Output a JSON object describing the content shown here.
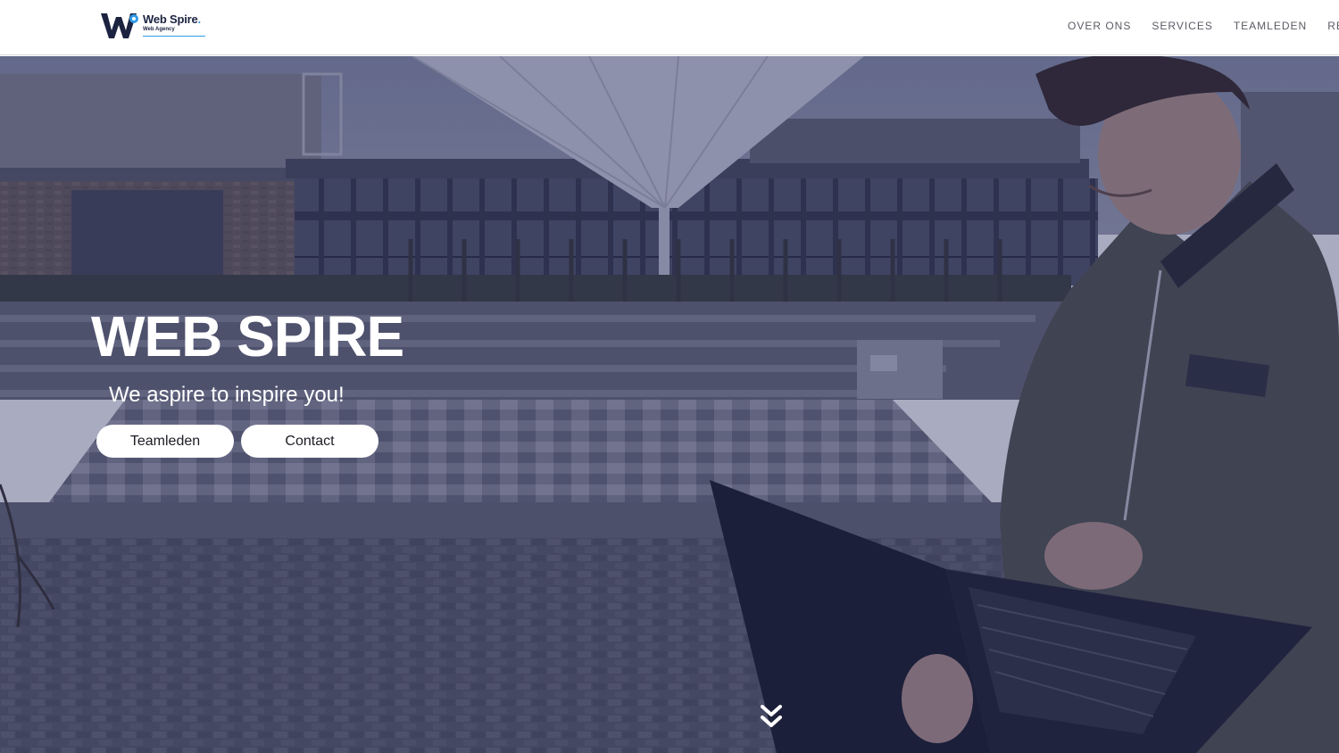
{
  "brand": {
    "name": "Web Spire",
    "name_dot": ".",
    "tagline": "Web Agency",
    "logo_icon": "w-letter-logo-icon",
    "primary_color": "#1b2340",
    "accent_color": "#2f9be8"
  },
  "nav": {
    "items": [
      {
        "label": "OVER ONS"
      },
      {
        "label": "SERVICES"
      },
      {
        "label": "TEAMLEDEN"
      },
      {
        "label": "REALISA"
      }
    ]
  },
  "hero": {
    "title": "WEB SPIRE",
    "subtitle": "We aspire to inspire you!",
    "buttons": {
      "team_label": "Teamleden",
      "contact_label": "Contact"
    },
    "scroll_icon": "double-chevron-down-icon",
    "overlay_color": "#1e225c"
  }
}
